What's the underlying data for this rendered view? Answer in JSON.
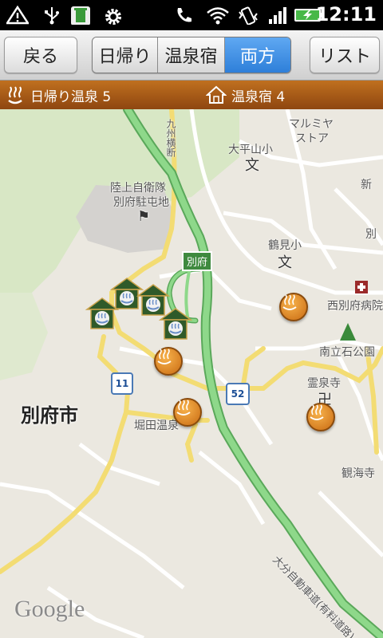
{
  "status_bar": {
    "time": "12:11",
    "icons": [
      "warning-icon",
      "usb-icon",
      "recycle-icon",
      "settings-icon",
      "phone-icon",
      "wifi-icon",
      "vibrate-icon",
      "signal-icon",
      "battery-charging-icon"
    ]
  },
  "toolbar": {
    "back_label": "戻る",
    "segments": [
      "日帰り",
      "温泉宿",
      "両方"
    ],
    "active_segment": "両方",
    "list_label": "リスト"
  },
  "category_bar": {
    "day_trip_label": "日帰り温泉 5",
    "inn_label": "温泉宿 4"
  },
  "map": {
    "labels": {
      "marumiya": "マルミヤ",
      "store": "ストア",
      "ohirayama": "大平山小",
      "jsdf1": "陸上自衛隊",
      "jsdf2": "別府駐屯地",
      "tsurumi": "鶴見小",
      "nishibeppu": "西別府病院",
      "minamitate": "南立石公園",
      "reisenji": "霊泉寺",
      "horita": "堀田温泉",
      "kankaiji": "観海寺",
      "shin": "新",
      "betsu": "別",
      "city": "別府市",
      "highway_sign": "別府",
      "route11": "11",
      "route52": "52",
      "expressway": "大分自動車道(有料道路)",
      "kunimi": "九州横断"
    },
    "attribution": "Google",
    "colors": {
      "expressway": "#7ccf7a",
      "national_road": "#f5e07a",
      "pin_orange": "#e38a24",
      "ryokan_green": "#2f5a2a"
    }
  }
}
